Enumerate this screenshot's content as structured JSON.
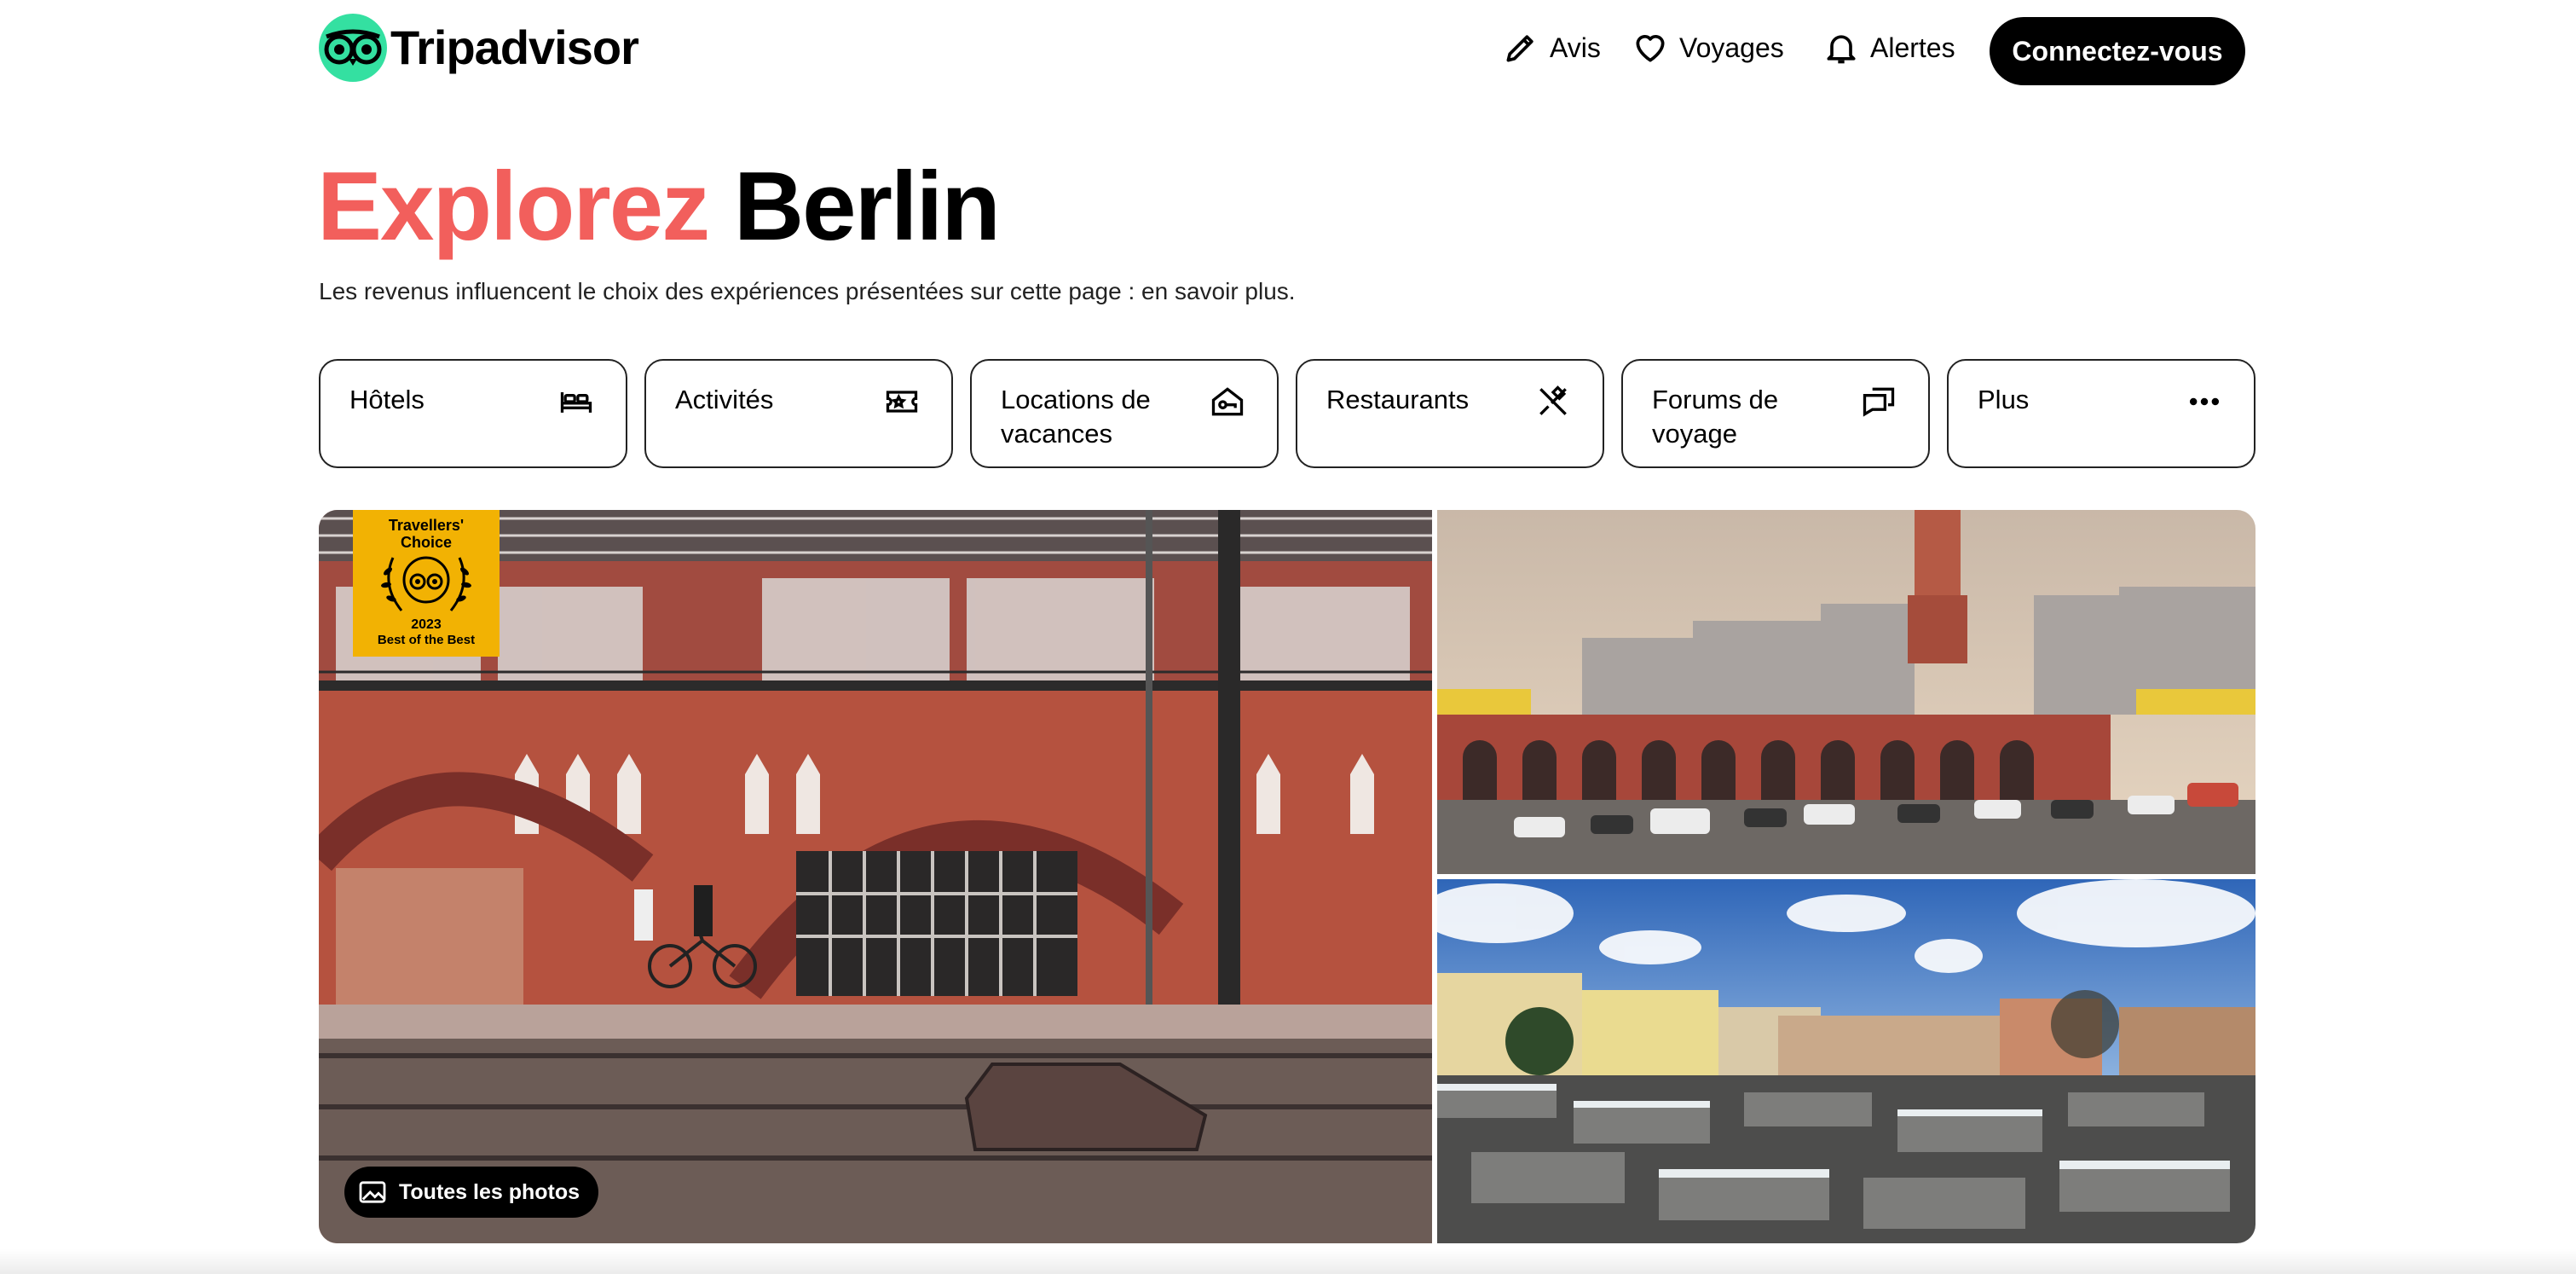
{
  "header": {
    "logo_text": "Tripadvisor",
    "nav": [
      {
        "label": "Avis",
        "icon": "pencil-icon"
      },
      {
        "label": "Voyages",
        "icon": "heart-icon"
      },
      {
        "label": "Alertes",
        "icon": "bell-icon"
      }
    ],
    "connect_label": "Connectez-vous"
  },
  "hero": {
    "title_accent": "Explorez",
    "title_place": "Berlin",
    "disclaimer": "Les revenus influencent le choix des expériences présentées sur cette page : en savoir plus."
  },
  "categories": [
    {
      "label": "Hôtels",
      "icon": "bed-icon"
    },
    {
      "label": "Activités",
      "icon": "ticket-icon"
    },
    {
      "label": "Locations de vacances",
      "icon": "house-key-icon"
    },
    {
      "label": "Restaurants",
      "icon": "fork-knife-icon"
    },
    {
      "label": "Forums de voyage",
      "icon": "chat-bubbles-icon"
    },
    {
      "label": "Plus",
      "icon": "more-dots-icon"
    }
  ],
  "gallery": {
    "award": {
      "line1": "Travellers'",
      "line2": "Choice",
      "year": "2023",
      "best": "Best of the Best"
    },
    "all_photos_label": "Toutes les photos"
  },
  "colors": {
    "accent": "#f25f5c",
    "brand_green": "#34e0a1",
    "award_yellow": "#f2b203"
  }
}
